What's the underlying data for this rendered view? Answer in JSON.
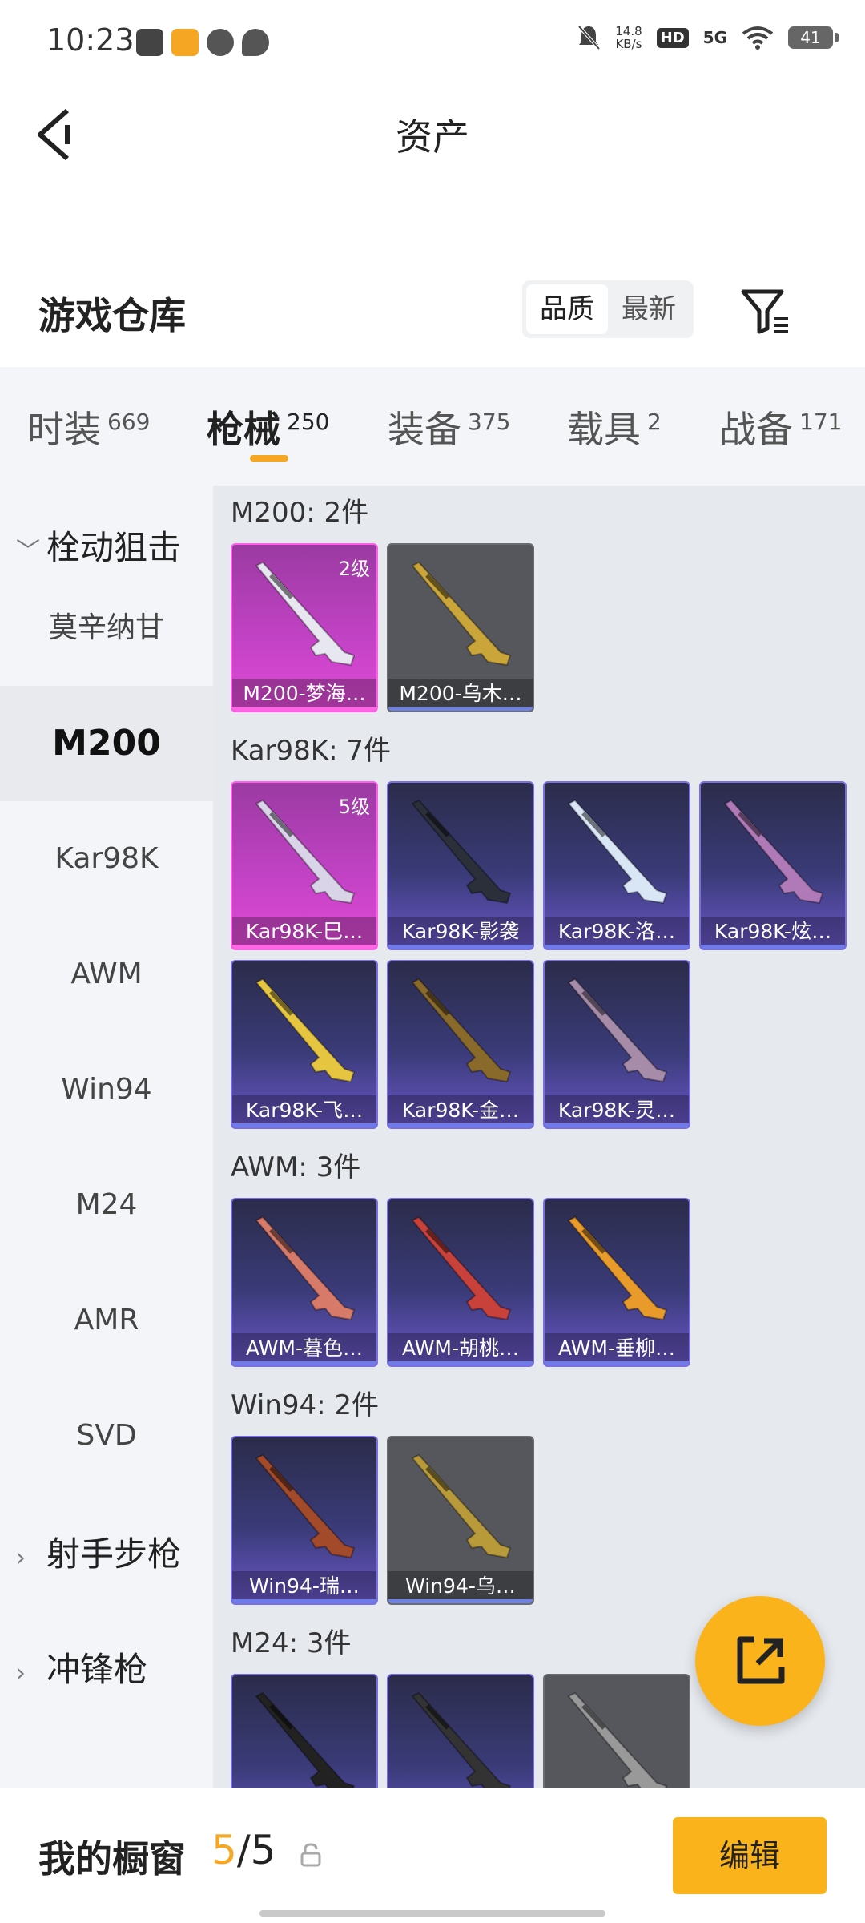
{
  "status_bar": {
    "time": "10:23",
    "net_speed_value": "14.8",
    "net_speed_unit": "KB/s",
    "hd": "HD",
    "signal": "5G",
    "battery": "41"
  },
  "header": {
    "title": "资产"
  },
  "warehouse": {
    "title": "游戏仓库",
    "sort_options": [
      "品质",
      "最新"
    ],
    "active_sort": "品质"
  },
  "category_tabs": [
    {
      "label": "时装",
      "count": "669"
    },
    {
      "label": "枪械",
      "count": "250"
    },
    {
      "label": "装备",
      "count": "375"
    },
    {
      "label": "载具",
      "count": "2"
    },
    {
      "label": "战备",
      "count": "171"
    }
  ],
  "sidebar": {
    "group_open": "栓动狙击",
    "items": [
      "莫辛纳甘",
      "M200",
      "Kar98K",
      "AWM",
      "Win94",
      "M24",
      "AMR",
      "SVD"
    ],
    "active_item": "M200",
    "groups_collapsed": [
      "射手步枪",
      "冲锋枪"
    ]
  },
  "sections": [
    {
      "title": "M200: 2件",
      "items": [
        {
          "name": "M200-梦海…",
          "rarity": "pink",
          "level": "2级"
        },
        {
          "name": "M200-乌木…",
          "rarity": "gray",
          "level": ""
        }
      ]
    },
    {
      "title": "Kar98K: 7件",
      "items": [
        {
          "name": "Kar98K-巳…",
          "rarity": "pink",
          "level": "5级"
        },
        {
          "name": "Kar98K-影袭",
          "rarity": "purple",
          "level": ""
        },
        {
          "name": "Kar98K-洛…",
          "rarity": "purple",
          "level": ""
        },
        {
          "name": "Kar98K-炫…",
          "rarity": "purple",
          "level": ""
        },
        {
          "name": "Kar98K-飞…",
          "rarity": "purple",
          "level": ""
        },
        {
          "name": "Kar98K-金…",
          "rarity": "purple",
          "level": ""
        },
        {
          "name": "Kar98K-灵…",
          "rarity": "purple",
          "level": ""
        }
      ]
    },
    {
      "title": "AWM: 3件",
      "items": [
        {
          "name": "AWM-暮色…",
          "rarity": "purple",
          "level": ""
        },
        {
          "name": "AWM-胡桃…",
          "rarity": "purple",
          "level": ""
        },
        {
          "name": "AWM-垂柳…",
          "rarity": "purple",
          "level": ""
        }
      ]
    },
    {
      "title": "Win94: 2件",
      "items": [
        {
          "name": "Win94-瑞…",
          "rarity": "purple",
          "level": ""
        },
        {
          "name": "Win94-乌…",
          "rarity": "gray",
          "level": ""
        }
      ]
    },
    {
      "title": "M24: 3件",
      "items": [
        {
          "name": "",
          "rarity": "purple",
          "level": ""
        },
        {
          "name": "",
          "rarity": "purple",
          "level": ""
        },
        {
          "name": "",
          "rarity": "gray",
          "level": ""
        }
      ]
    }
  ],
  "showcase": {
    "title": "我的橱窗",
    "current": "5",
    "total": "5",
    "edit_label": "编辑"
  },
  "colors": {
    "accent": "#fbb31b",
    "rarity_pink": "#e24ad8",
    "rarity_purple": "#6b57c9",
    "rarity_gray": "#55575c"
  }
}
